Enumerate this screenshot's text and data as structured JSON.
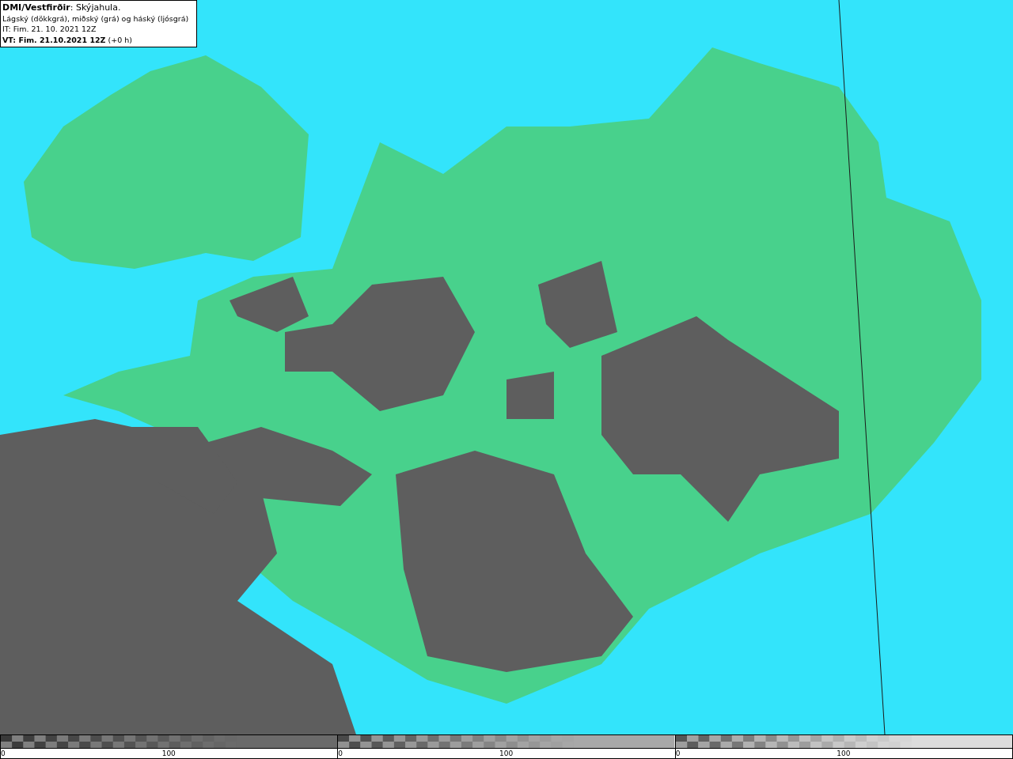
{
  "legend": {
    "lines": [
      "**DMI/Vestfirðir**: Skýjahula.",
      "Lágský (dökkgrá), miðský (grá) og háský (ljósgrá)",
      "IT: Fim. 21. 10. 2021 12Z",
      "**VT: Fim. 21.10.2021 12Z** (+0 h)"
    ]
  },
  "scales": [
    {
      "color": "#6a6a6a",
      "min_label": "0",
      "mid_label": "100"
    },
    {
      "color": "#a8a8a8",
      "min_label": "0",
      "mid_label": "100"
    },
    {
      "color": "#dcdcdc",
      "min_label": "0",
      "mid_label": "100"
    }
  ]
}
